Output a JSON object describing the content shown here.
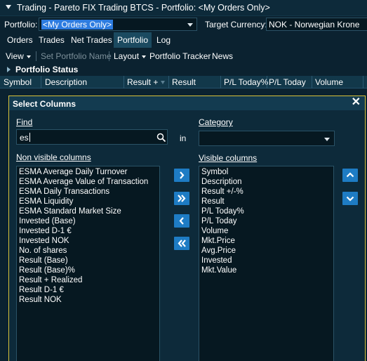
{
  "window": {
    "title": "Trading - Pareto FIX Trading BTCS - Portfolio: <My Orders Only>"
  },
  "portfolio_row": {
    "portfolio_label": "Portfolio:",
    "portfolio_value": "<My Orders Only>",
    "currency_label": "Target Currency:",
    "currency_value": "NOK - Norwegian Krone"
  },
  "tabs": [
    "Orders",
    "Trades",
    "Net Trades",
    "Portfolio",
    "Log"
  ],
  "active_tab": "Portfolio",
  "toolbar": {
    "view": "View",
    "set_portfolio_name": "Set Portfolio Name",
    "layout": "Layout",
    "portfolio_tracker": "Portfolio Tracker",
    "news": "News"
  },
  "status": {
    "title": "Portfolio Status"
  },
  "grid": {
    "columns": [
      "Symbol",
      "Description",
      "Result +",
      "Result",
      "P/L Today%",
      "P/L Today",
      "Volume"
    ]
  },
  "dialog": {
    "title": "Select Columns",
    "find_label": "Find",
    "find_value": "es",
    "in_label": "in",
    "category_label": "Category",
    "category_value": "",
    "non_visible_label": "Non visible columns",
    "visible_label": "Visible columns",
    "non_visible_columns": [
      "ESMA Average Daily Turnover",
      "ESMA Average Value of Transaction",
      "ESMA Daily Transactions",
      "ESMA Liquidity",
      "ESMA Standard Market Size",
      "Invested (Base)",
      "Invested D-1 €",
      "Invested NOK",
      "No. of shares",
      "Result (Base)",
      "Result (Base)%",
      "Result + Realized",
      "Result D-1 €",
      "Result NOK"
    ],
    "visible_columns": [
      "Symbol",
      "Description",
      "Result +/-%",
      "Result",
      "P/L Today%",
      "P/L Today",
      "Volume",
      "Mkt.Price",
      "Avg.Price",
      "Invested",
      "Mkt.Value"
    ]
  },
  "colors": {
    "background": "#0b2230",
    "accent_button": "#1e7cc4",
    "dialog_border": "#d8c23a",
    "selection": "#2d7ce0"
  }
}
